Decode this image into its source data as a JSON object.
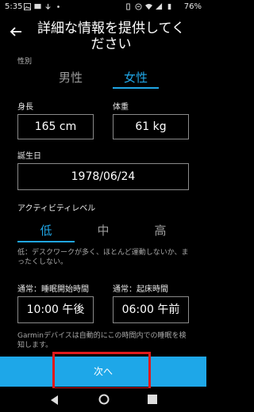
{
  "status": {
    "time": "5:35",
    "battery": "76%"
  },
  "header": {
    "title": "詳細な情報を提供してください"
  },
  "partial_label": "性別",
  "gender": {
    "male": "男性",
    "female": "女性",
    "selected": "女性"
  },
  "height": {
    "label": "身長",
    "value": "165 cm"
  },
  "weight": {
    "label": "体重",
    "value": "61 kg"
  },
  "birthday": {
    "label": "誕生日",
    "value": "1978/06/24"
  },
  "activity": {
    "label": "アクティビティレベル",
    "low": "低",
    "mid": "中",
    "high": "高",
    "selected": "低",
    "description": "低：デスクワークが多く、ほとんど運動しないか、まったくしない。"
  },
  "sleep_start": {
    "label": "通常：睡眠開始時間",
    "value": "10:00 午後"
  },
  "wake_time": {
    "label": "通常：起床時間",
    "value": "06:00 午前"
  },
  "note": "Garminデバイスは自動的にこの時間内での睡眠を検知します。",
  "next_button": {
    "label": "次へ"
  },
  "colors": {
    "accent": "#20a6e6",
    "button_bg": "#1ea7e8",
    "highlight": "#e0191b",
    "background": "#000000"
  }
}
